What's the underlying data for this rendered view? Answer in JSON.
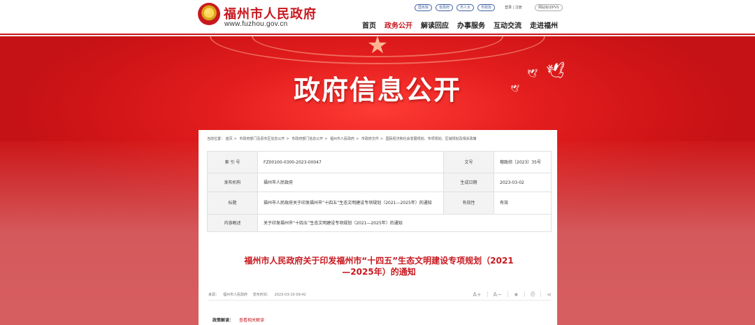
{
  "header": {
    "site_name": "福州市人民政府",
    "site_url": "www.fuzhou.gov.cn",
    "top_links": [
      "国务院",
      "省政府",
      "市人大",
      "市政协"
    ],
    "login": "登录 | 注册",
    "lang_pill": "网站标识PVS",
    "nav": [
      "首页",
      "政务公开",
      "解读回应",
      "办事服务",
      "互动交流",
      "走进福州"
    ],
    "nav_active": "政务公开"
  },
  "banner": {
    "title": "政府信息公开"
  },
  "breadcrumb": [
    "当前位置：",
    "首页",
    "市政府部门及县市区信息公开",
    "市政府部门信息公开",
    "福州市人民政府",
    "市政府文件",
    "国民经济和社会发展规划、专项规划、区域规划及相关政策"
  ],
  "meta": {
    "index_label": "索 引 号",
    "index_value": "FZ00100-0300-2023-00047",
    "docno_label": "文号",
    "docno_value": "榕政综〔2023〕35号",
    "publisher_label": "发布机构",
    "publisher_value": "福州市人民政府",
    "date_label": "生成日期",
    "date_value": "2023-03-02",
    "title_label": "标题",
    "title_value": "福州市人民政府关于印发福州市“十四五”生态文明建设专项规划（2021—2025年）的通知",
    "validity_label": "有效性",
    "validity_value": "有效",
    "summary_label": "内容概述",
    "summary_value": "关于印发福州市“十四五”生态文明建设专项规划（2021—2025年）的通知"
  },
  "doc": {
    "title": "福州市人民政府关于印发福州市“十四五”生态文明建设专项规划（2021—2025年）的通知",
    "source_label": "来源：",
    "source_value": "福州市人民政府",
    "pubtime_label": "发布时间：",
    "pubtime_value": "2023-03-10 09:42",
    "tools": [
      "A+",
      "A−",
      "★",
      "⎙",
      "⋖"
    ],
    "policy_label": "政策解读：",
    "policy_link": "查看相关解读"
  },
  "colors": {
    "brand_red": "#c8181f",
    "banner_red": "#e31d1d",
    "link_blue": "#3d5fa0"
  }
}
